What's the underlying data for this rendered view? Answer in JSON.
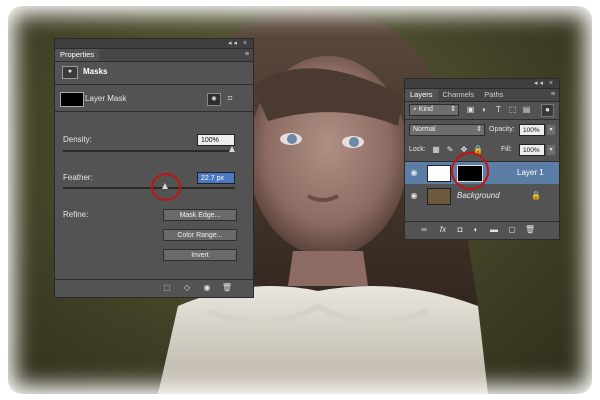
{
  "properties": {
    "title": "Properties",
    "section_label": "Masks",
    "mask_label": "Layer Mask",
    "density_label": "Density:",
    "density_value": "100%",
    "feather_label": "Feather:",
    "feather_value": "22.7 px",
    "refine_label": "Refine:",
    "mask_edge_button": "Mask Edge...",
    "color_range_button": "Color Range...",
    "invert_button": "Invert"
  },
  "layers": {
    "tabs": [
      "Layers",
      "Channels",
      "Paths"
    ],
    "active_tab": "Layers",
    "kind_filter": "Kind",
    "blend_mode": "Normal",
    "opacity_label": "Opacity:",
    "opacity_value": "100%",
    "lock_label": "Lock:",
    "fill_label": "Fill:",
    "fill_value": "100%",
    "items": [
      {
        "name": "Layer 1",
        "selected": true
      },
      {
        "name": "Background",
        "selected": false
      }
    ]
  },
  "colors": {
    "panel_bg": "#535353",
    "highlight_circle": "#c41212",
    "selection_blue": "#5c7ea6"
  }
}
